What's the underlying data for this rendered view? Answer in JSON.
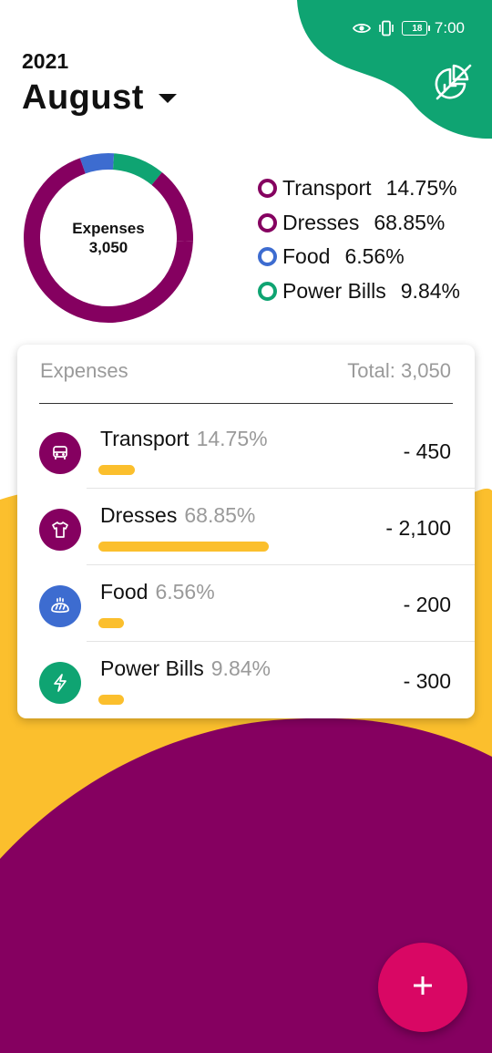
{
  "status_bar": {
    "battery_level": "18",
    "time": "7:00",
    "icons": [
      "eye-icon",
      "vibrate-icon",
      "battery-icon"
    ]
  },
  "header": {
    "year": "2021",
    "month": "August",
    "icons": [
      "dropdown-caret-icon",
      "pie-chart-leaf-icon"
    ]
  },
  "summary": {
    "label": "Expenses",
    "total": "3,050"
  },
  "categories": [
    {
      "name": "Transport",
      "percent": "14.75%",
      "share": 0.1475,
      "amount": "- 450",
      "color": "#850060",
      "icon": "car-icon"
    },
    {
      "name": "Dresses",
      "percent": "68.85%",
      "share": 0.6885,
      "amount": "- 2,100",
      "color": "#850060",
      "icon": "tshirt-icon"
    },
    {
      "name": "Food",
      "percent": "6.56%",
      "share": 0.0656,
      "amount": "- 200",
      "color": "#3d6cd0",
      "icon": "bread-icon"
    },
    {
      "name": "Power Bills",
      "percent": "9.84%",
      "share": 0.0984,
      "amount": "- 300",
      "color": "#0fa472",
      "icon": "lightning-icon"
    }
  ],
  "card": {
    "title": "Expenses",
    "total_label": "Total: 3,050"
  },
  "fab": {
    "icon": "plus-icon"
  },
  "colors": {
    "green": "#0fa472",
    "purple": "#850060",
    "yellow": "#fbbf2d",
    "blue": "#3d6cd0",
    "fab": "#d90764"
  }
}
